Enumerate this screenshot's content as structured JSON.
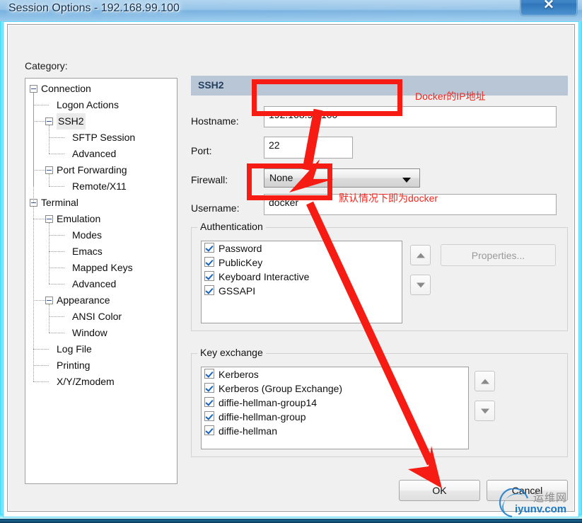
{
  "window": {
    "title": "Session Options - 192.168.99.100",
    "close_label": "✕"
  },
  "sidebar": {
    "category_label": "Category:",
    "items": [
      {
        "label": "Connection",
        "depth": 0,
        "expandable": true,
        "selected": false
      },
      {
        "label": "Logon Actions",
        "depth": 1,
        "expandable": false,
        "selected": false
      },
      {
        "label": "SSH2",
        "depth": 1,
        "expandable": true,
        "selected": true
      },
      {
        "label": "SFTP Session",
        "depth": 2,
        "expandable": false,
        "selected": false
      },
      {
        "label": "Advanced",
        "depth": 2,
        "expandable": false,
        "selected": false
      },
      {
        "label": "Port Forwarding",
        "depth": 1,
        "expandable": true,
        "selected": false
      },
      {
        "label": "Remote/X11",
        "depth": 2,
        "expandable": false,
        "selected": false
      },
      {
        "label": "Terminal",
        "depth": 0,
        "expandable": true,
        "selected": false
      },
      {
        "label": "Emulation",
        "depth": 1,
        "expandable": true,
        "selected": false
      },
      {
        "label": "Modes",
        "depth": 2,
        "expandable": false,
        "selected": false
      },
      {
        "label": "Emacs",
        "depth": 2,
        "expandable": false,
        "selected": false
      },
      {
        "label": "Mapped Keys",
        "depth": 2,
        "expandable": false,
        "selected": false
      },
      {
        "label": "Advanced",
        "depth": 2,
        "expandable": false,
        "selected": false
      },
      {
        "label": "Appearance",
        "depth": 1,
        "expandable": true,
        "selected": false
      },
      {
        "label": "ANSI Color",
        "depth": 2,
        "expandable": false,
        "selected": false
      },
      {
        "label": "Window",
        "depth": 2,
        "expandable": false,
        "selected": false
      },
      {
        "label": "Log File",
        "depth": 1,
        "expandable": false,
        "selected": false
      },
      {
        "label": "Printing",
        "depth": 1,
        "expandable": false,
        "selected": false
      },
      {
        "label": "X/Y/Zmodem",
        "depth": 1,
        "expandable": false,
        "selected": false
      }
    ]
  },
  "pane": {
    "header": "SSH2",
    "fields": {
      "hostname_label": "Hostname:",
      "hostname_value": "192.168.99.100",
      "port_label": "Port:",
      "port_value": "22",
      "firewall_label": "Firewall:",
      "firewall_value": "None",
      "username_label": "Username:",
      "username_value": "docker"
    },
    "authentication": {
      "title": "Authentication",
      "items": [
        {
          "label": "Password",
          "checked": true
        },
        {
          "label": "PublicKey",
          "checked": true
        },
        {
          "label": "Keyboard Interactive",
          "checked": true
        },
        {
          "label": "GSSAPI",
          "checked": true
        }
      ],
      "properties_label": "Properties...",
      "properties_enabled": false,
      "move_up_icon": "triangle-up-icon",
      "move_down_icon": "triangle-down-icon"
    },
    "key_exchange": {
      "title": "Key exchange",
      "items": [
        {
          "label": "Kerberos",
          "checked": true
        },
        {
          "label": "Kerberos (Group Exchange)",
          "checked": true
        },
        {
          "label": "diffie-hellman-group14",
          "checked": true
        },
        {
          "label": "diffie-hellman-group",
          "checked": true
        },
        {
          "label": "diffie-hellman",
          "checked": true
        }
      ],
      "move_up_icon": "triangle-up-icon",
      "move_down_icon": "triangle-down-icon"
    }
  },
  "footer": {
    "ok_label": "OK",
    "cancel_label": "Cancel"
  },
  "annotations": {
    "hostname_note": "Docker的IP地址",
    "username_note": "默认情况下即为docker",
    "highlight_color": "#f61b13",
    "note_color": "#f4231b"
  },
  "watermark": {
    "cn_text": "运维网",
    "url_text": "iyunv.com",
    "logo_icon": "swoosh-circle-icon",
    "logo_color": "#1878c8"
  }
}
